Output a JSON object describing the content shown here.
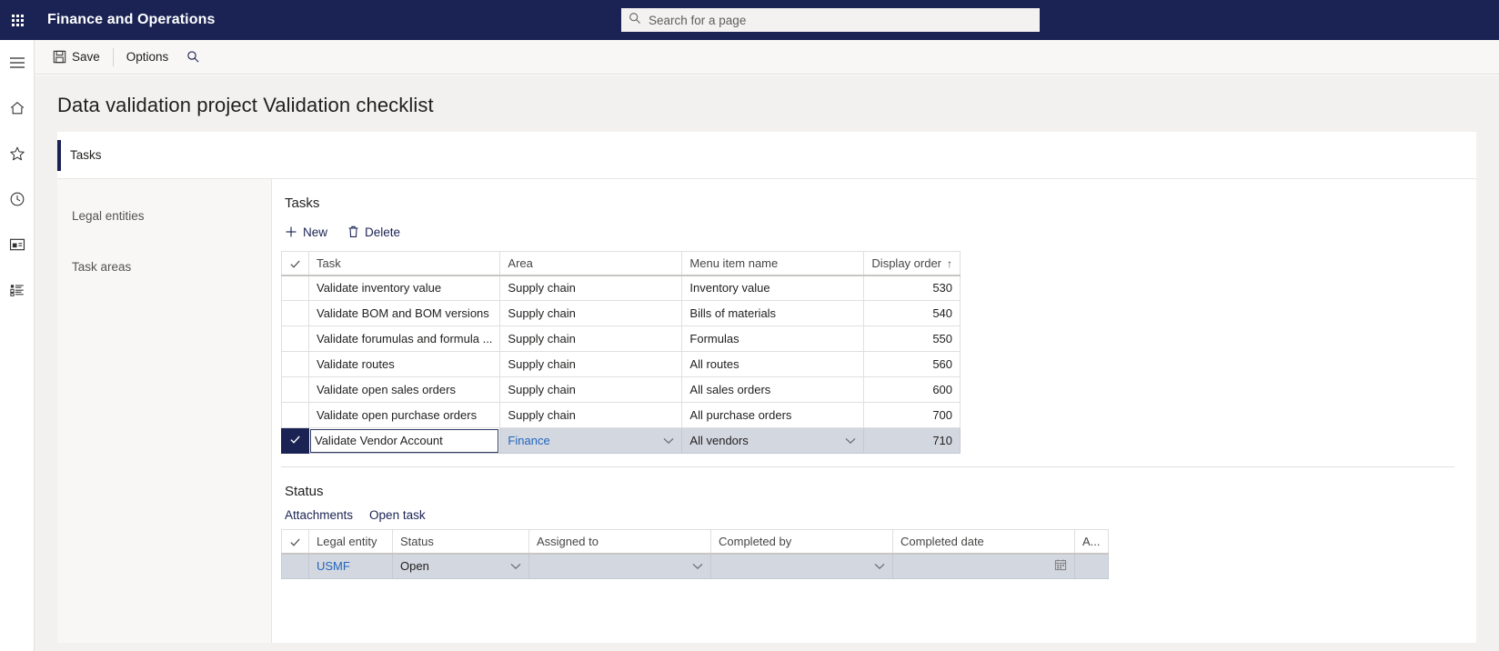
{
  "topbar": {
    "waffle_icon": "app-launcher-icon",
    "app_title": "Finance and Operations",
    "search": {
      "icon": "search-icon",
      "placeholder": "Search for a page",
      "value": ""
    }
  },
  "rail": {
    "items": [
      {
        "icon": "hamburger-menu-icon",
        "name": "nav-menu-toggle"
      },
      {
        "icon": "home-icon",
        "name": "rail-home"
      },
      {
        "icon": "star-icon",
        "name": "rail-favorites"
      },
      {
        "icon": "clock-icon",
        "name": "rail-recent"
      },
      {
        "icon": "workspace-icon",
        "name": "rail-workspaces"
      },
      {
        "icon": "list-icon",
        "name": "rail-modules"
      }
    ]
  },
  "command_bar": {
    "save_label": "Save",
    "save_icon": "save-disk-icon",
    "options_label": "Options",
    "search_icon": "search-icon"
  },
  "page": {
    "title": "Data validation project Validation checklist"
  },
  "tabs": [
    {
      "label": "Tasks",
      "active": true
    }
  ],
  "left_nav": {
    "items": [
      {
        "label": "Legal entities"
      },
      {
        "label": "Task areas"
      }
    ]
  },
  "tasks_section": {
    "title": "Tasks",
    "toolbar": {
      "new_label": "New",
      "new_icon": "plus-icon",
      "delete_label": "Delete",
      "delete_icon": "trash-icon"
    },
    "columns": [
      {
        "key": "check",
        "label": "",
        "icon": "checkmark-icon"
      },
      {
        "key": "task",
        "label": "Task"
      },
      {
        "key": "area",
        "label": "Area"
      },
      {
        "key": "menu_item_name",
        "label": "Menu item name"
      },
      {
        "key": "display_order",
        "label": "Display order",
        "sort": "↑"
      }
    ],
    "rows": [
      {
        "task": "Validate inventory value",
        "area": "Supply chain",
        "menu_item_name": "Inventory value",
        "display_order": "530"
      },
      {
        "task": "Validate BOM and BOM versions",
        "area": "Supply chain",
        "menu_item_name": "Bills of materials",
        "display_order": "540"
      },
      {
        "task": "Validate forumulas and formula ...",
        "area": "Supply chain",
        "menu_item_name": "Formulas",
        "display_order": "550"
      },
      {
        "task": "Validate routes",
        "area": "Supply chain",
        "menu_item_name": "All routes",
        "display_order": "560"
      },
      {
        "task": "Validate open sales orders",
        "area": "Supply chain",
        "menu_item_name": "All sales orders",
        "display_order": "600"
      },
      {
        "task": "Validate open purchase orders",
        "area": "Supply chain",
        "menu_item_name": "All purchase orders",
        "display_order": "700"
      }
    ],
    "editing_row": {
      "selected": true,
      "task_value": "Validate Vendor Account",
      "area_value": "Finance",
      "menu_item_value": "All vendors",
      "display_order": "710"
    }
  },
  "status_section": {
    "title": "Status",
    "toolbar": {
      "attachments_label": "Attachments",
      "open_task_label": "Open task"
    },
    "columns": [
      {
        "key": "check",
        "label": "",
        "icon": "checkmark-icon"
      },
      {
        "key": "legal_entity",
        "label": "Legal entity"
      },
      {
        "key": "status",
        "label": "Status"
      },
      {
        "key": "assigned_to",
        "label": "Assigned to"
      },
      {
        "key": "completed_by",
        "label": "Completed by"
      },
      {
        "key": "completed_date",
        "label": "Completed date"
      },
      {
        "key": "a",
        "label": "A..."
      }
    ],
    "rows": [
      {
        "legal_entity": "USMF",
        "status": "Open",
        "assigned_to": "",
        "completed_by": "",
        "completed_date": "",
        "a": ""
      }
    ]
  },
  "colors": {
    "brand_navy": "#1b2354",
    "link_blue": "#2266bb",
    "selected_row": "#d3d7e0",
    "page_bg": "#f2f1f0",
    "command_bar_bg": "#f8f7f6"
  }
}
